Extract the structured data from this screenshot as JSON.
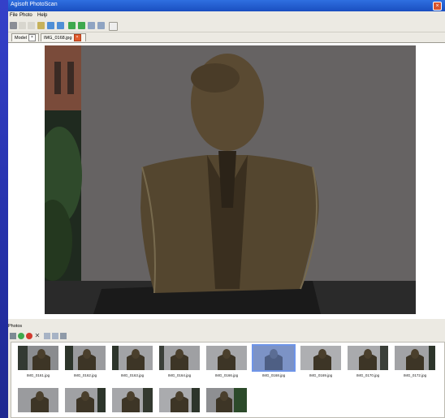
{
  "window": {
    "title": "Agisoft PhotoScan",
    "close_icon": "close-icon"
  },
  "menu": {
    "items": [
      "File",
      "Photo",
      "Help"
    ]
  },
  "tabs": [
    {
      "label": "Model",
      "close": "×"
    },
    {
      "label": "IMG_0168.jpg",
      "close": "×"
    }
  ],
  "panel": {
    "title": "Photos"
  },
  "photos": [
    {
      "name": "IMG_0161.jpg",
      "selected": false
    },
    {
      "name": "IMG_0162.jpg",
      "selected": false
    },
    {
      "name": "IMG_0163.jpg",
      "selected": false
    },
    {
      "name": "IMG_0164.jpg",
      "selected": false
    },
    {
      "name": "IMG_0166.jpg",
      "selected": false
    },
    {
      "name": "IMG_0168.jpg",
      "selected": true
    },
    {
      "name": "IMG_0169.jpg",
      "selected": false
    },
    {
      "name": "IMG_0170.jpg",
      "selected": false
    },
    {
      "name": "IMG_0172.jpg",
      "selected": false
    }
  ],
  "colors": {
    "accent": "#2f6fe0",
    "selected": "#6f95e8",
    "close": "#e05a2c"
  }
}
